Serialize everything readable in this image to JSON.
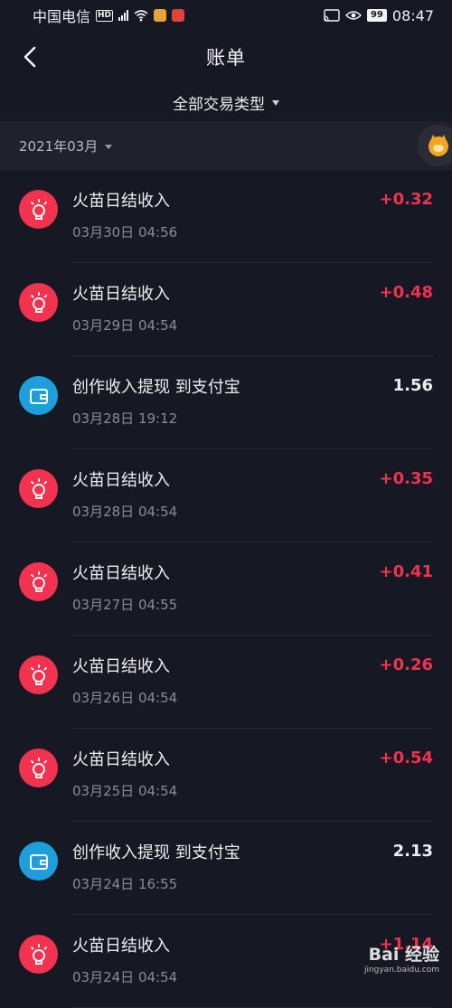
{
  "status_bar": {
    "carrier": "中国电信",
    "hd": "HD",
    "network": "4G",
    "battery": "99",
    "time": "08:47"
  },
  "header": {
    "title": "账单",
    "filter_label": "全部交易类型",
    "month_label": "2021年03月"
  },
  "colors": {
    "background": "#161823",
    "income_red": "#f1334f",
    "alipay_blue": "#1e9fdc"
  },
  "transactions": [
    {
      "name": "火苗日结收入",
      "time": "03月30日 04:56",
      "amount": "+0.32",
      "icon": "lightbulb-icon"
    },
    {
      "name": "火苗日结收入",
      "time": "03月29日 04:54",
      "amount": "+0.48",
      "icon": "lightbulb-icon"
    },
    {
      "name": "创作收入提现 到支付宝",
      "time": "03月28日 19:12",
      "amount": "1.56",
      "icon": "wallet-icon"
    },
    {
      "name": "火苗日结收入",
      "time": "03月28日 04:54",
      "amount": "+0.35",
      "icon": "lightbulb-icon"
    },
    {
      "name": "火苗日结收入",
      "time": "03月27日 04:55",
      "amount": "+0.41",
      "icon": "lightbulb-icon"
    },
    {
      "name": "火苗日结收入",
      "time": "03月26日 04:54",
      "amount": "+0.26",
      "icon": "lightbulb-icon"
    },
    {
      "name": "火苗日结收入",
      "time": "03月25日 04:54",
      "amount": "+0.54",
      "icon": "lightbulb-icon"
    },
    {
      "name": "创作收入提现 到支付宝",
      "time": "03月24日 16:55",
      "amount": "2.13",
      "icon": "wallet-icon"
    },
    {
      "name": "火苗日结收入",
      "time": "03月24日 04:54",
      "amount": "+1.14",
      "icon": "lightbulb-icon"
    }
  ],
  "watermark": {
    "main": "Bai 经验",
    "sub": "jingyan.baidu.com"
  }
}
